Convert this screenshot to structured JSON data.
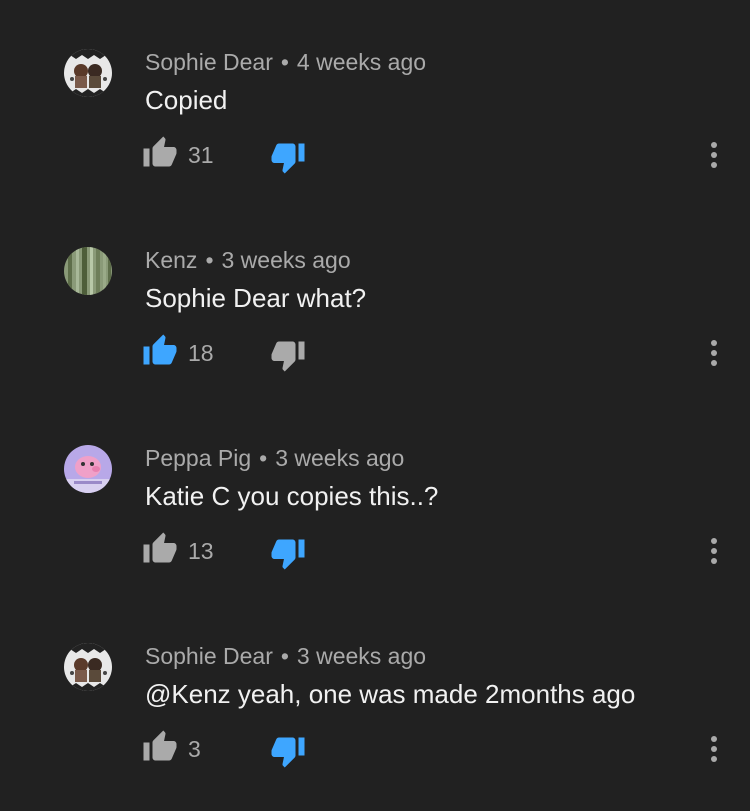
{
  "colors": {
    "background": "#212121",
    "meta_text": "#aaaaaa",
    "body_text": "#f1f1f1",
    "active_blue": "#3ea6ff",
    "inactive_gray": "#aaaaaa"
  },
  "comments": [
    {
      "author": "Sophie Dear",
      "separator": "•",
      "time": "4 weeks ago",
      "text": "Copied",
      "likes": "31",
      "liked": false,
      "disliked": true,
      "avatar_icon": "anime-characters-avatar-icon"
    },
    {
      "author": "Kenz",
      "separator": "•",
      "time": "3 weeks ago",
      "text": "Sophie Dear what?",
      "likes": "18",
      "liked": true,
      "disliked": false,
      "avatar_icon": "forest-avatar-icon"
    },
    {
      "author": "Peppa Pig",
      "separator": "•",
      "time": "3 weeks ago",
      "text": "Katie C you copies this..?",
      "likes": "13",
      "liked": false,
      "disliked": true,
      "avatar_icon": "pink-cartoon-avatar-icon"
    },
    {
      "author": "Sophie Dear",
      "separator": "•",
      "time": "3 weeks ago",
      "text": "@Kenz yeah, one was made 2months ago",
      "likes": "3",
      "liked": false,
      "disliked": true,
      "avatar_icon": "anime-characters-avatar-icon"
    }
  ]
}
